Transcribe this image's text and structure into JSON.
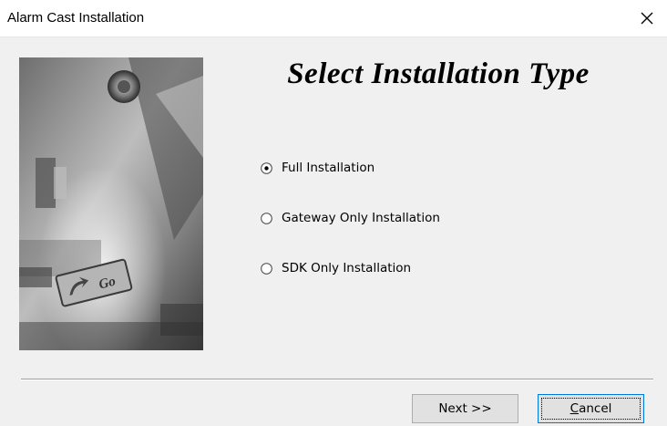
{
  "window": {
    "title": "Alarm Cast Installation"
  },
  "hero": {
    "badge_text": "Go"
  },
  "main": {
    "heading": "Select Installation Type",
    "options": [
      {
        "label": "Full Installation",
        "selected": true
      },
      {
        "label": "Gateway Only Installation",
        "selected": false
      },
      {
        "label": "SDK Only Installation",
        "selected": false
      }
    ]
  },
  "buttons": {
    "next_label": "Next >>",
    "cancel_mnemonic": "C",
    "cancel_rest": "ancel"
  },
  "colors": {
    "client_bg": "#f0f0f0",
    "button_bg": "#e1e1e1",
    "focus_border": "#0078d7"
  }
}
